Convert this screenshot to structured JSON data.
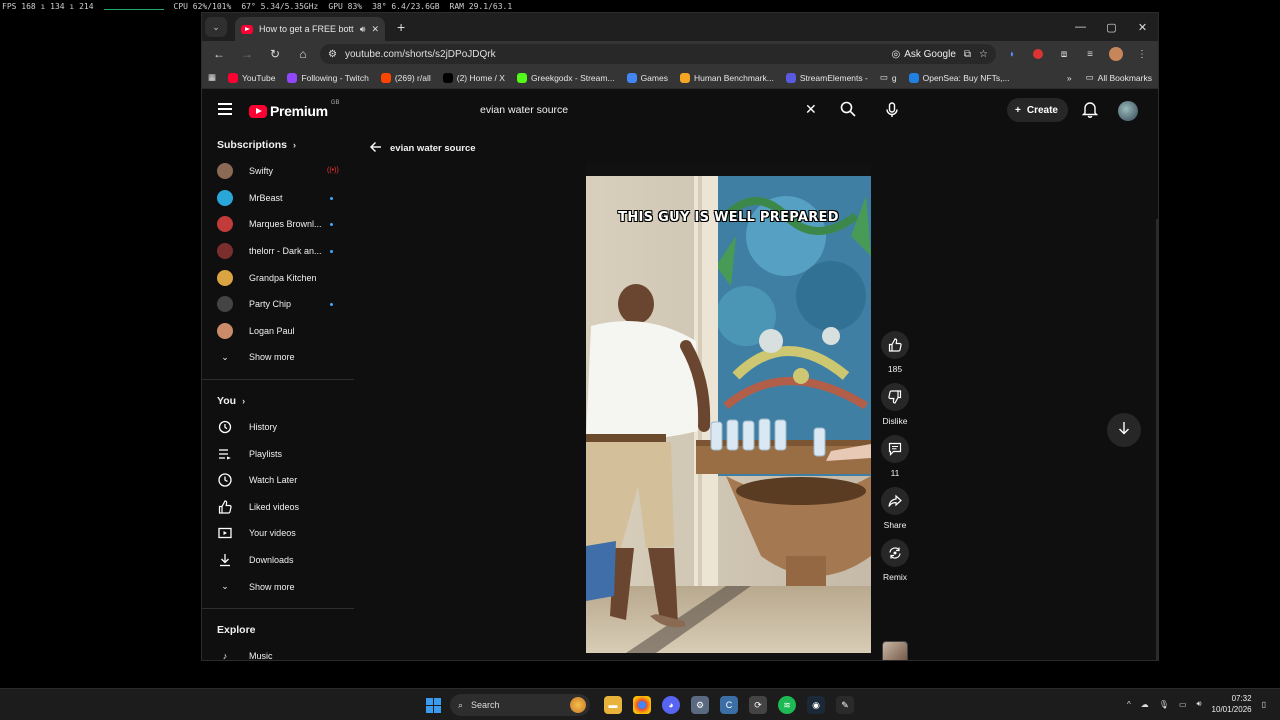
{
  "overlay": {
    "fps": "FPS 168 ı 134 ı 214",
    "cpu": "CPU 62%/101%",
    "cpu_extra": "67°  5.34/5.35GHz",
    "gpu": "GPU 83%",
    "gpu_extra": "38°  6.4/23.6GB",
    "ram": "RAM 29.1/63.1"
  },
  "browser": {
    "tab_title": "How to get a FREE bottle of",
    "url": "youtube.com/shorts/s2jDPoJDQrk",
    "ask_google": "Ask Google",
    "bookmarks": [
      {
        "label": "YouTube",
        "color": "#ff0033"
      },
      {
        "label": "Following - Twitch",
        "color": "#9146ff"
      },
      {
        "label": "(269) r/all",
        "color": "#ff4500"
      },
      {
        "label": "(2) Home / X",
        "color": "#000000"
      },
      {
        "label": "Greekgodx - Stream...",
        "color": "#53fc18"
      },
      {
        "label": "Games",
        "color": "#4285f4"
      },
      {
        "label": "Human Benchmark...",
        "color": "#f5a623"
      },
      {
        "label": "StreamElements -",
        "color": "#5a5ae0"
      },
      {
        "label": "g",
        "color": "#888888"
      },
      {
        "label": "OpenSea: Buy NFTs,...",
        "color": "#2081e2"
      }
    ],
    "all_bookmarks": "All Bookmarks"
  },
  "youtube": {
    "logo_text": "Premium",
    "logo_region": "GB",
    "search_value": "evian water source",
    "create_label": "Create",
    "subscriptions_title": "Subscriptions",
    "subscriptions": [
      {
        "name": "Swifty",
        "status": "live",
        "color": "#8a6a55"
      },
      {
        "name": "MrBeast",
        "status": "dot",
        "color": "#2aa7d9"
      },
      {
        "name": "Marques Brownl...",
        "status": "dot",
        "color": "#c23b3b"
      },
      {
        "name": "thelorr - Dark an...",
        "status": "dot",
        "color": "#7a2e2e"
      },
      {
        "name": "Grandpa Kitchen",
        "status": "",
        "color": "#d9a441"
      },
      {
        "name": "Party Chip",
        "status": "dot",
        "color": "#444444"
      },
      {
        "name": "Logan Paul",
        "status": "",
        "color": "#c98b6a"
      }
    ],
    "show_more_1": "Show more",
    "you_title": "You",
    "you_items": [
      {
        "label": "History",
        "icon": "history-icon"
      },
      {
        "label": "Playlists",
        "icon": "playlists-icon"
      },
      {
        "label": "Watch Later",
        "icon": "clock-icon"
      },
      {
        "label": "Liked videos",
        "icon": "thumbs-up-icon"
      },
      {
        "label": "Your videos",
        "icon": "video-icon"
      },
      {
        "label": "Downloads",
        "icon": "download-icon"
      }
    ],
    "show_more_2": "Show more",
    "explore_title": "Explore",
    "explore_first": "Music",
    "back_label": "evian water source",
    "short_caption": "THIS GUY IS WELL PREPARED",
    "actions": {
      "likes": "185",
      "dislike": "Dislike",
      "comments": "11",
      "share": "Share",
      "remix": "Remix"
    }
  },
  "taskbar": {
    "search_label": "Search",
    "time": "07:32",
    "date": "10/01/2026"
  }
}
